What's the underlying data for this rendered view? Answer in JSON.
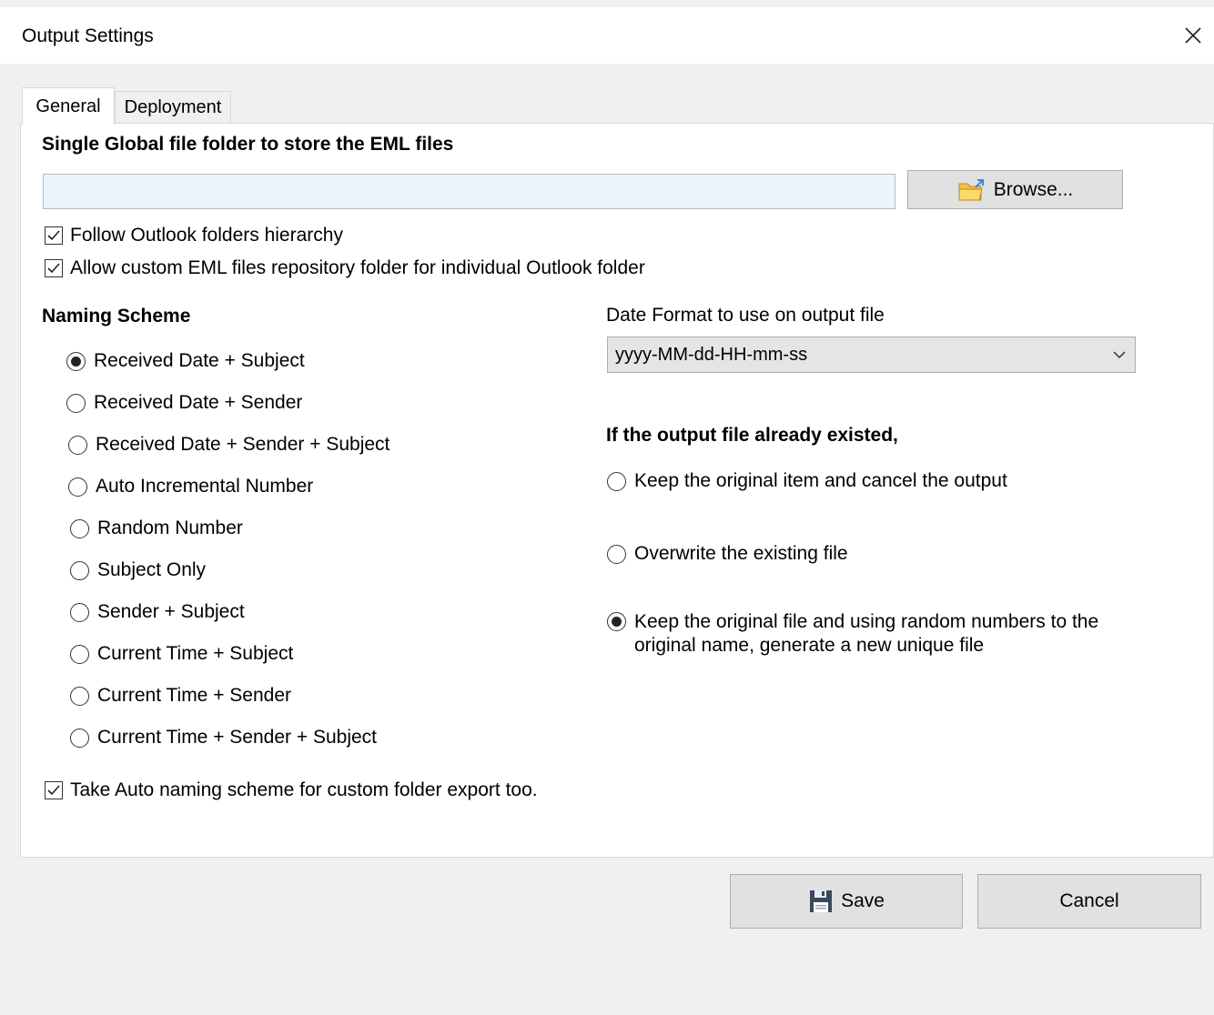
{
  "window": {
    "title": "Output Settings"
  },
  "tabs": [
    {
      "label": "General",
      "selected": true
    },
    {
      "label": "Deployment",
      "selected": false
    }
  ],
  "folder": {
    "heading": "Single Global file folder to store the EML files",
    "path_value": "",
    "browse_label": "Browse..."
  },
  "options": {
    "follow_hierarchy": {
      "label": "Follow Outlook folders hierarchy",
      "checked": true
    },
    "allow_custom": {
      "label": "Allow custom EML files repository folder for individual Outlook folder",
      "checked": true
    }
  },
  "naming": {
    "heading": "Naming Scheme",
    "selected": 0,
    "items": [
      "Received Date + Subject",
      "Received Date + Sender",
      "Received Date + Sender + Subject",
      "Auto Incremental Number",
      "Random Number",
      "Subject Only",
      "Sender + Subject",
      "Current Time + Subject",
      "Current Time + Sender",
      "Current Time + Sender + Subject"
    ],
    "auto_naming": {
      "label": "Take Auto naming scheme for custom folder export too.",
      "checked": true
    }
  },
  "date_format": {
    "label": "Date Format to use on output file",
    "value": "yyyy-MM-dd-HH-mm-ss"
  },
  "existing": {
    "heading": "If the output file already existed,",
    "selected": 2,
    "items": [
      "Keep the original item and cancel the output",
      "Overwrite the existing file",
      "Keep the original file and using random numbers to the original name, generate a new unique file"
    ]
  },
  "buttons": {
    "save_label": "Save",
    "cancel_label": "Cancel"
  },
  "colors": {
    "input_bg": "#eaf4fd",
    "button_bg": "#e1e1e1",
    "panel_bg": "#ffffff",
    "window_bg": "#f0f0f0"
  },
  "icons": {
    "browse": "folder-icon",
    "save": "floppy-disk-icon",
    "close": "close-icon",
    "dropdown": "chevron-down-icon"
  }
}
